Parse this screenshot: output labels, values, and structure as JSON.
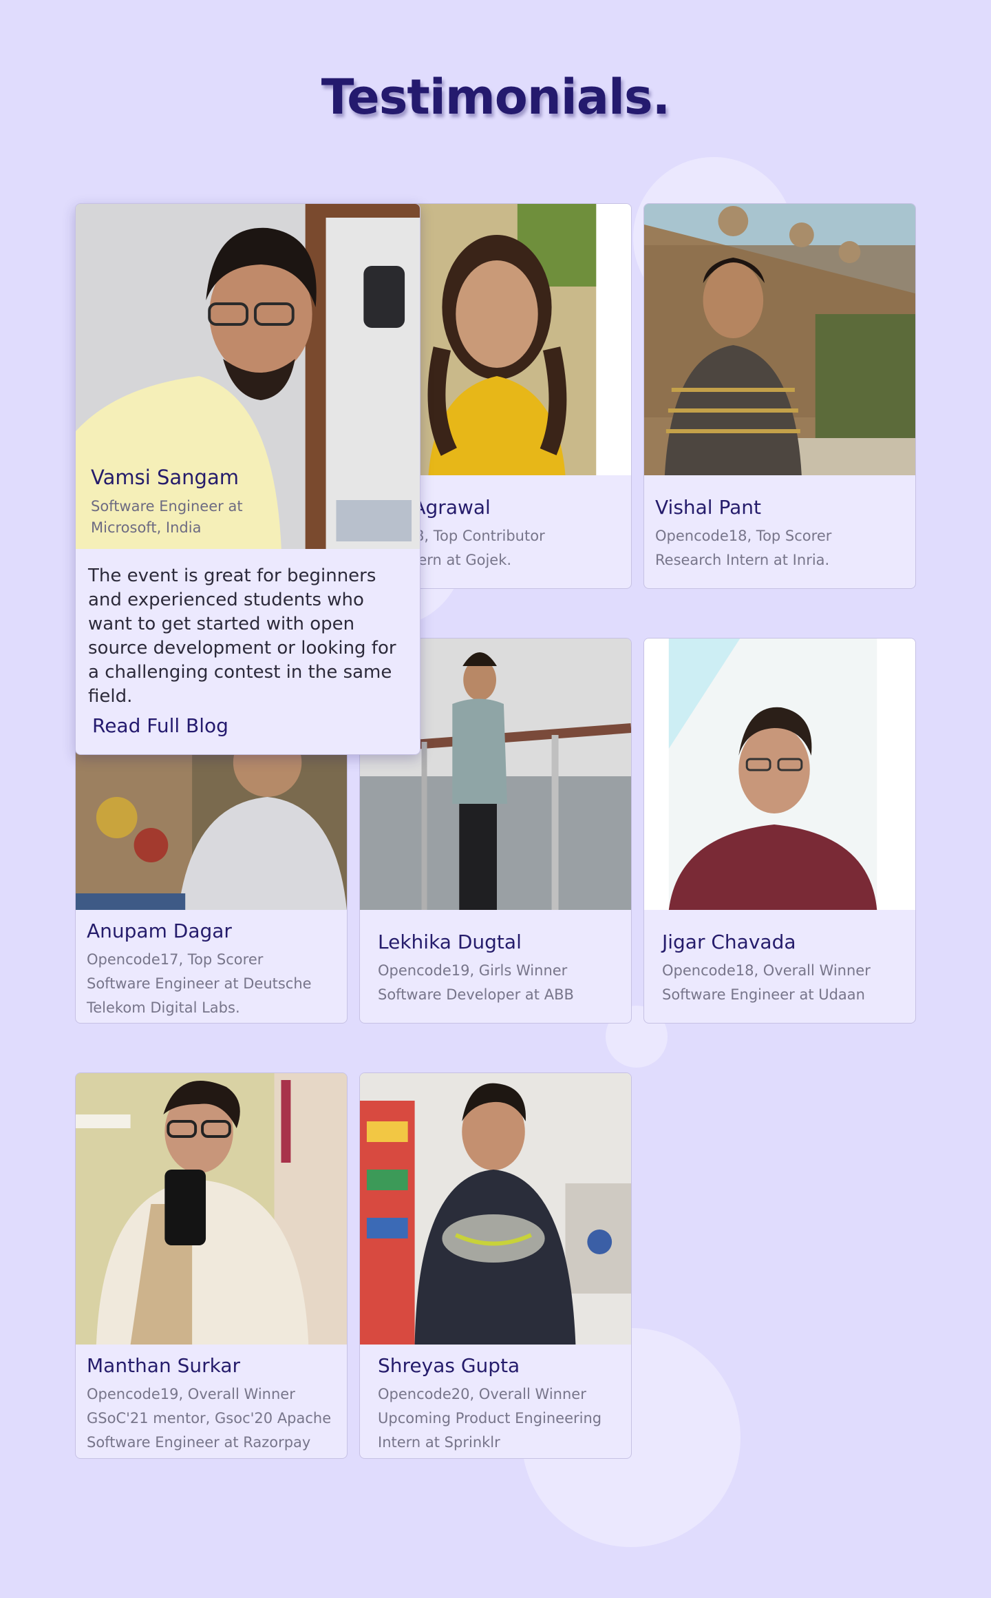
{
  "page": {
    "title": "Testimonials."
  },
  "popup": {
    "name": "Vamsi Sangam",
    "subtitle": "Software Engineer at Microsoft, India",
    "quote": "The event is great for beginners and experienced students who want to get started with open source development or looking for a challenging contest in the same field.",
    "read_label": "Read Full Blog"
  },
  "cards": [
    {
      "name": "Vamsi Sangam",
      "lines": [
        "Software Engineer at",
        "Microsoft, India"
      ]
    },
    {
      "name": "nya Agrawal",
      "lines": [
        "code18, Top Contributor",
        "are Intern at Gojek."
      ]
    },
    {
      "name": "Vishal Pant",
      "lines": [
        "Opencode18, Top Scorer",
        "Research Intern at Inria."
      ]
    },
    {
      "name": "Anupam Dagar",
      "lines": [
        "Opencode17, Top Scorer",
        "Software Engineer at Deutsche",
        "Telekom Digital Labs."
      ]
    },
    {
      "name": "Lekhika Dugtal",
      "lines": [
        "Opencode19, Girls Winner",
        "Software Developer at ABB"
      ]
    },
    {
      "name": "Jigar Chavada",
      "lines": [
        "Opencode18, Overall Winner",
        "Software Engineer at Udaan"
      ]
    },
    {
      "name": "Manthan Surkar",
      "lines": [
        "Opencode19, Overall Winner",
        "GSoC'21 mentor, Gsoc'20 Apache",
        "Software Engineer at Razorpay"
      ]
    },
    {
      "name": "Shreyas Gupta",
      "lines": [
        "Opencode20, Overall Winner",
        "Upcoming Product Engineering",
        "Intern at Sprinklr"
      ]
    }
  ]
}
